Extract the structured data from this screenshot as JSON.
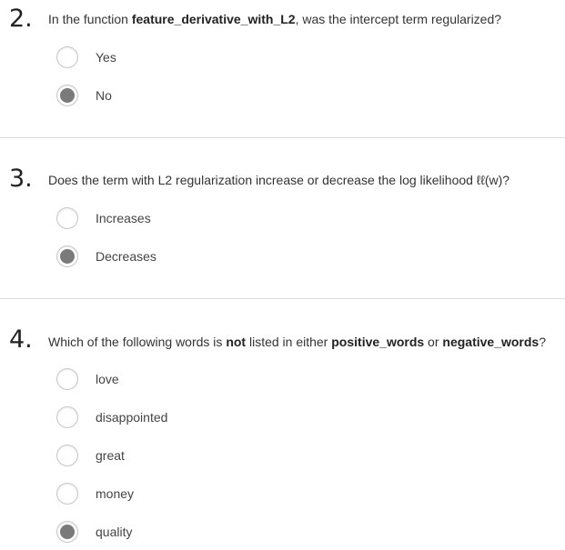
{
  "questions": [
    {
      "number": "2.",
      "text_parts": [
        "In the function ",
        "feature_derivative_with_L2",
        ", was the intercept term regularized?"
      ],
      "options": [
        {
          "label": "Yes",
          "selected": false
        },
        {
          "label": "No",
          "selected": true
        }
      ]
    },
    {
      "number": "3.",
      "text_parts": [
        "Does the term with L2 regularization increase or decrease the log likelihood ℓℓ(w)?"
      ],
      "options": [
        {
          "label": "Increases",
          "selected": false
        },
        {
          "label": "Decreases",
          "selected": true
        }
      ]
    },
    {
      "number": "4.",
      "text_parts": [
        "Which of the following words is ",
        "not",
        " listed in either ",
        "positive_words",
        " or ",
        "negative_words",
        "?"
      ],
      "options": [
        {
          "label": "love",
          "selected": false
        },
        {
          "label": "disappointed",
          "selected": false
        },
        {
          "label": "great",
          "selected": false
        },
        {
          "label": "money",
          "selected": false
        },
        {
          "label": "quality",
          "selected": true
        }
      ]
    }
  ]
}
